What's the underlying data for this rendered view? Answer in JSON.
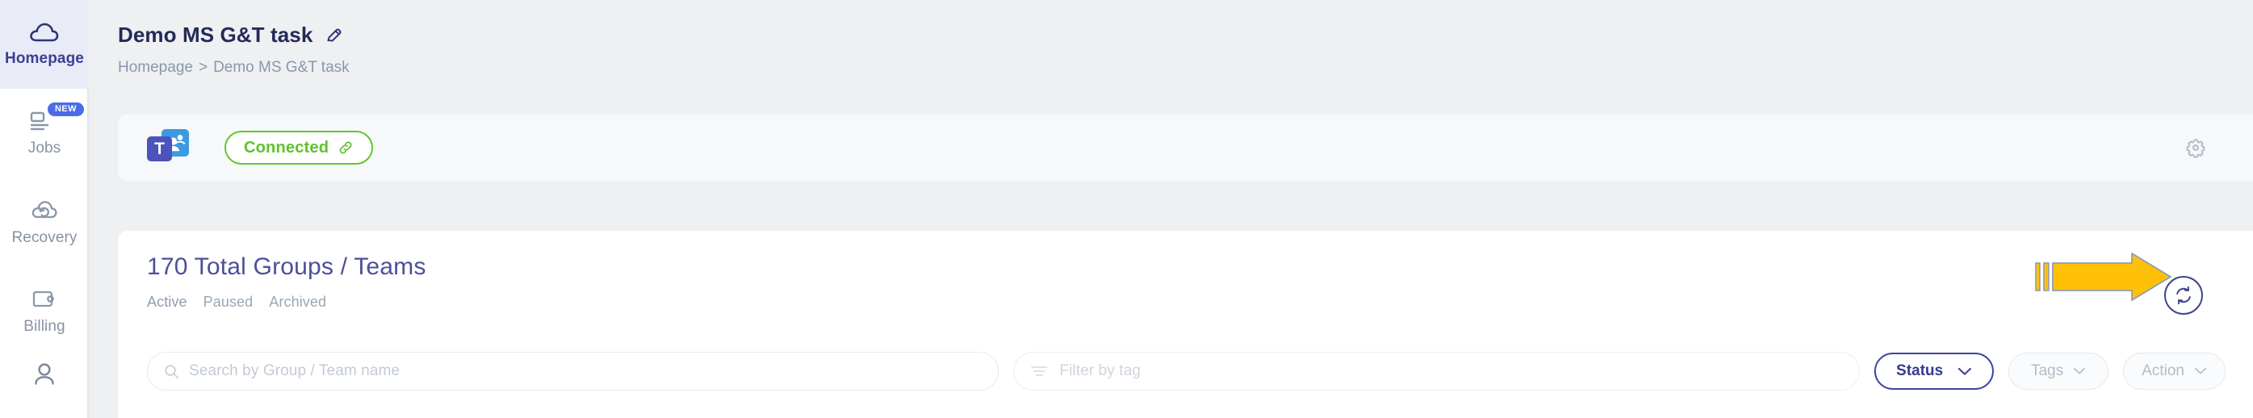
{
  "sidebar": {
    "items": [
      {
        "label": "Homepage",
        "icon": "cloud-icon",
        "active": true,
        "badge": null
      },
      {
        "label": "Jobs",
        "icon": "jobs-list-icon",
        "active": false,
        "badge": "NEW"
      },
      {
        "label": "Recovery",
        "icon": "recovery-cloud-icon",
        "active": false,
        "badge": null
      },
      {
        "label": "Billing",
        "icon": "wallet-icon",
        "active": false,
        "badge": null
      },
      {
        "label": "",
        "icon": "user-icon",
        "active": false,
        "badge": null
      }
    ]
  },
  "header": {
    "title": "Demo MS G&T task",
    "edit_icon": "pencil-icon",
    "breadcrumb": {
      "home": "Homepage",
      "separator": ">",
      "current": "Demo MS G&T task"
    }
  },
  "connection": {
    "service_icon": "ms-teams-icon",
    "service_letter": "T",
    "status_label": "Connected",
    "status_icon": "link-icon",
    "status_color": "#5ec22c",
    "settings_icon": "gear-icon"
  },
  "main": {
    "title": "170 Total Groups / Teams",
    "total_count": "170",
    "title_color": "#4c4f9b",
    "tabs": [
      {
        "label": "Active",
        "active": true
      },
      {
        "label": "Paused",
        "active": false
      },
      {
        "label": "Archived",
        "active": false
      }
    ],
    "refresh_icon": "refresh-icon",
    "search": {
      "icon": "search-icon",
      "placeholder": "Search by Group / Team name",
      "value": ""
    },
    "tag_filter": {
      "icon": "filter-icon",
      "placeholder": "Filter by tag",
      "value": ""
    },
    "buttons": [
      {
        "label": "Status",
        "icon": "chevron-down-icon",
        "style": "primary"
      },
      {
        "label": "Tags",
        "icon": "chevron-down-icon",
        "style": "muted"
      },
      {
        "label": "Action",
        "icon": "chevron-down-icon",
        "style": "muted"
      }
    ]
  },
  "annotation": {
    "arrow_icon": "right-arrow-annotation",
    "arrow_color": "#FFC107",
    "arrow_outline": "#8f9cb6"
  }
}
